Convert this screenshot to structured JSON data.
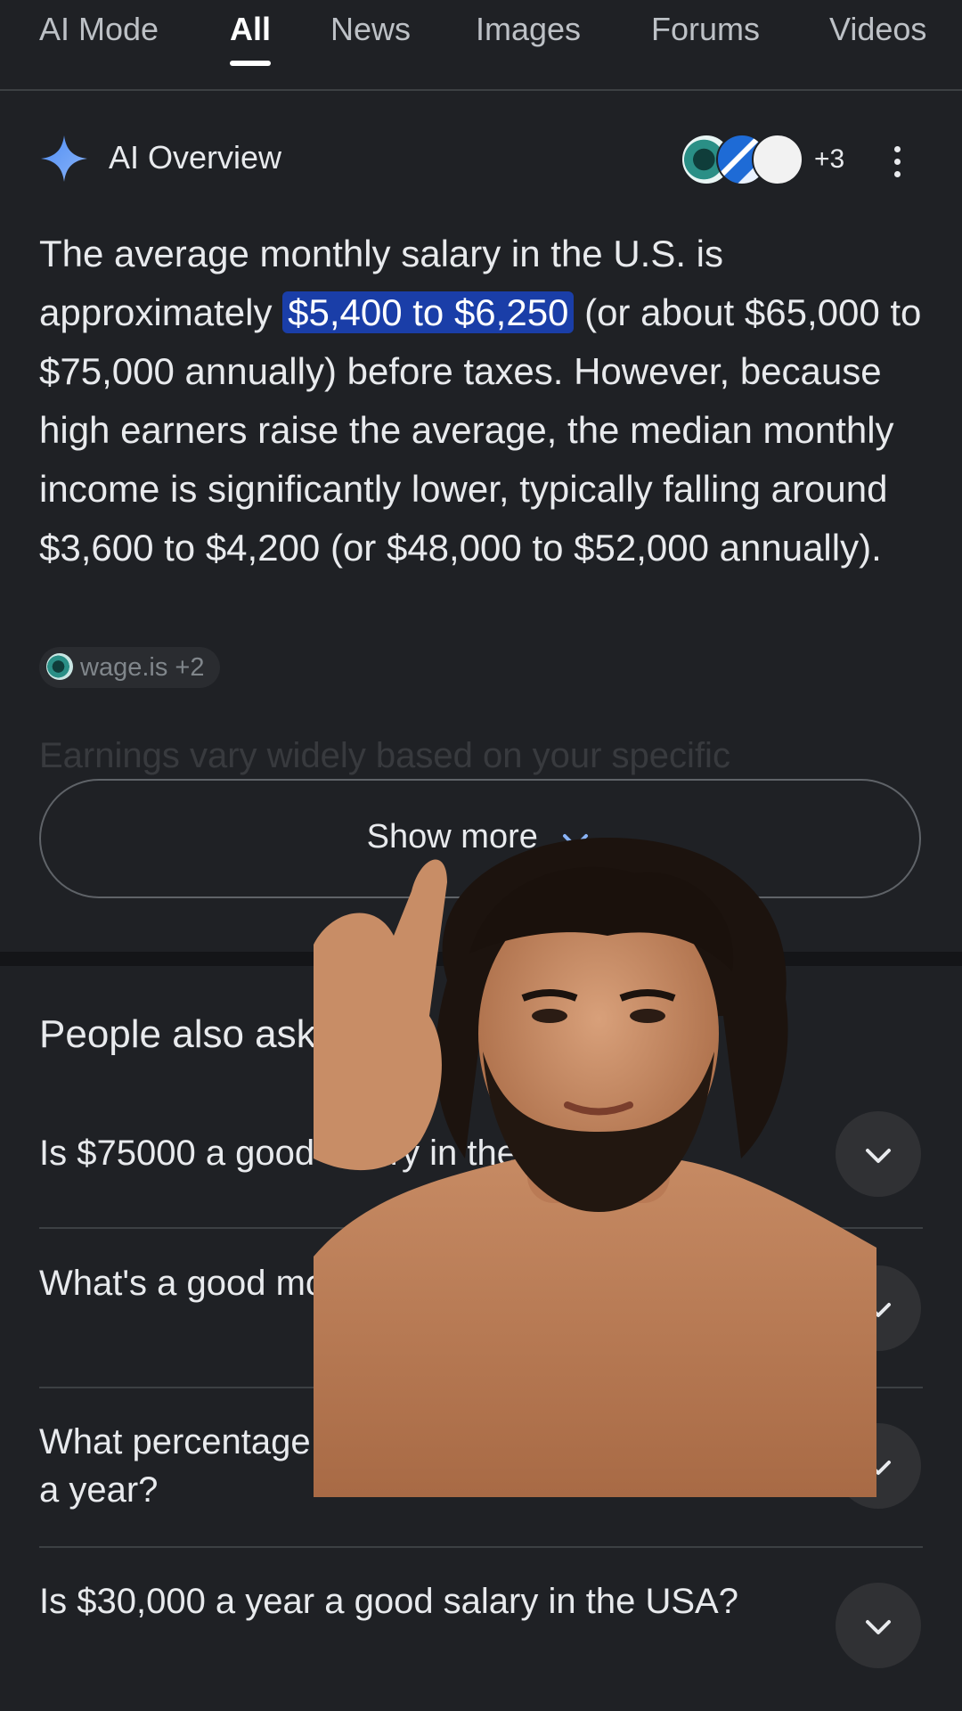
{
  "tabs": [
    {
      "label": "AI Mode",
      "active": false
    },
    {
      "label": "All",
      "active": true
    },
    {
      "label": "News",
      "active": false
    },
    {
      "label": "Images",
      "active": false
    },
    {
      "label": "Forums",
      "active": false
    },
    {
      "label": "Videos",
      "active": false
    }
  ],
  "ai_overview": {
    "title": "AI Overview",
    "sources_extra": "+3",
    "text_before": "The average monthly salary in the U.S. is approximately ",
    "text_highlight": "$5,400 to $6,250",
    "text_after": " (or about $65,000 to $75,000 annually) before taxes. However, because high earners raise the average, the median monthly income is significantly lower, typically falling around $3,600 to $4,200 (or $48,000 to $52,000 annually).",
    "source_chip": "wage.is +2",
    "faded_text": "Earnings vary widely based on your specific",
    "show_more": "Show more"
  },
  "people_also_ask": {
    "title": "People also ask",
    "questions": [
      "Is $75000 a good salary in the USA?",
      "What's a good monthly salary in the USA?",
      "What percentage of Americans make $100,000 a year?",
      "Is $30,000 a year a good salary in the USA?"
    ]
  },
  "colors": {
    "background": "#1f2125",
    "highlight": "#1a3ea8",
    "accent_blue": "#8ab4f8"
  }
}
